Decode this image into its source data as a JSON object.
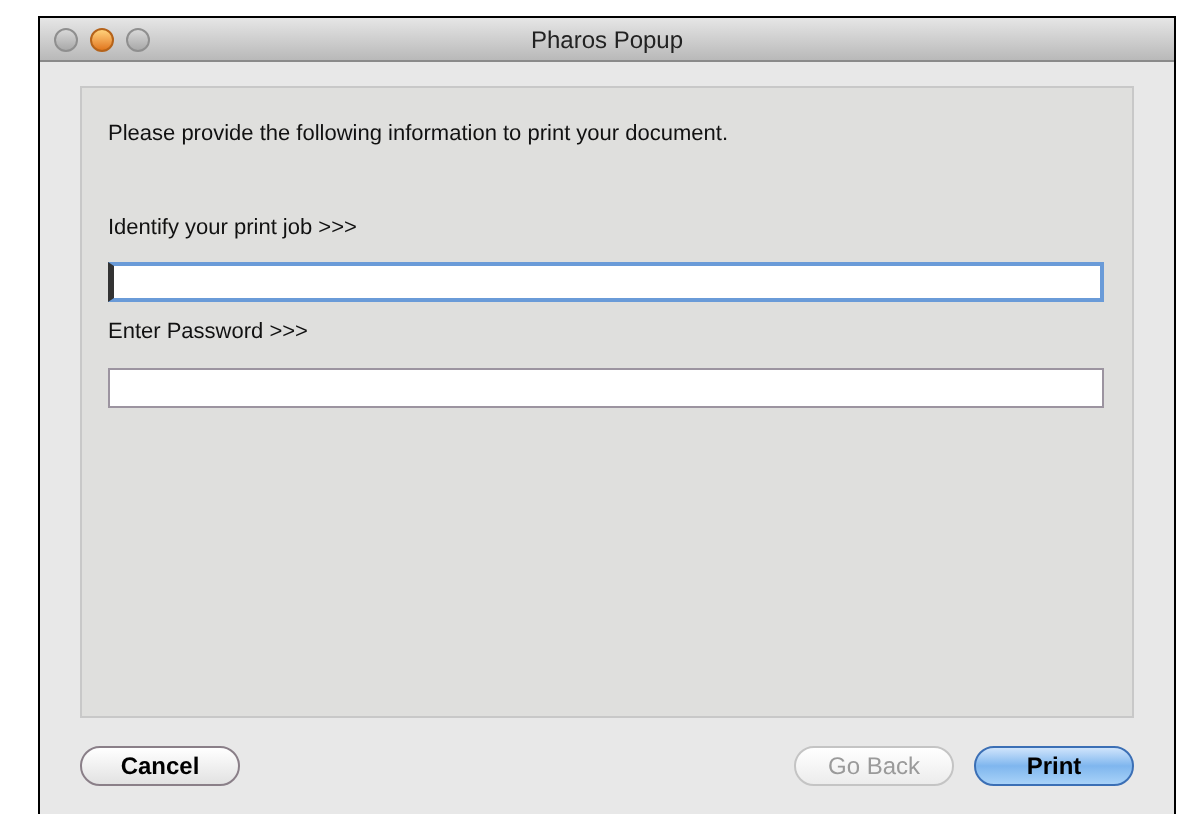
{
  "window": {
    "title": "Pharos Popup"
  },
  "instructions": "Please provide the following information to print your document.",
  "fields": [
    {
      "label": "Identify your print job >>>",
      "focused": true
    },
    {
      "label": "Enter Password >>>",
      "focused": false
    }
  ],
  "buttons": [
    {
      "label": "Cancel",
      "disabled": false,
      "default": false
    },
    {
      "label": "Go Back",
      "disabled": true,
      "default": false
    },
    {
      "label": "Print",
      "disabled": false,
      "default": true
    }
  ]
}
